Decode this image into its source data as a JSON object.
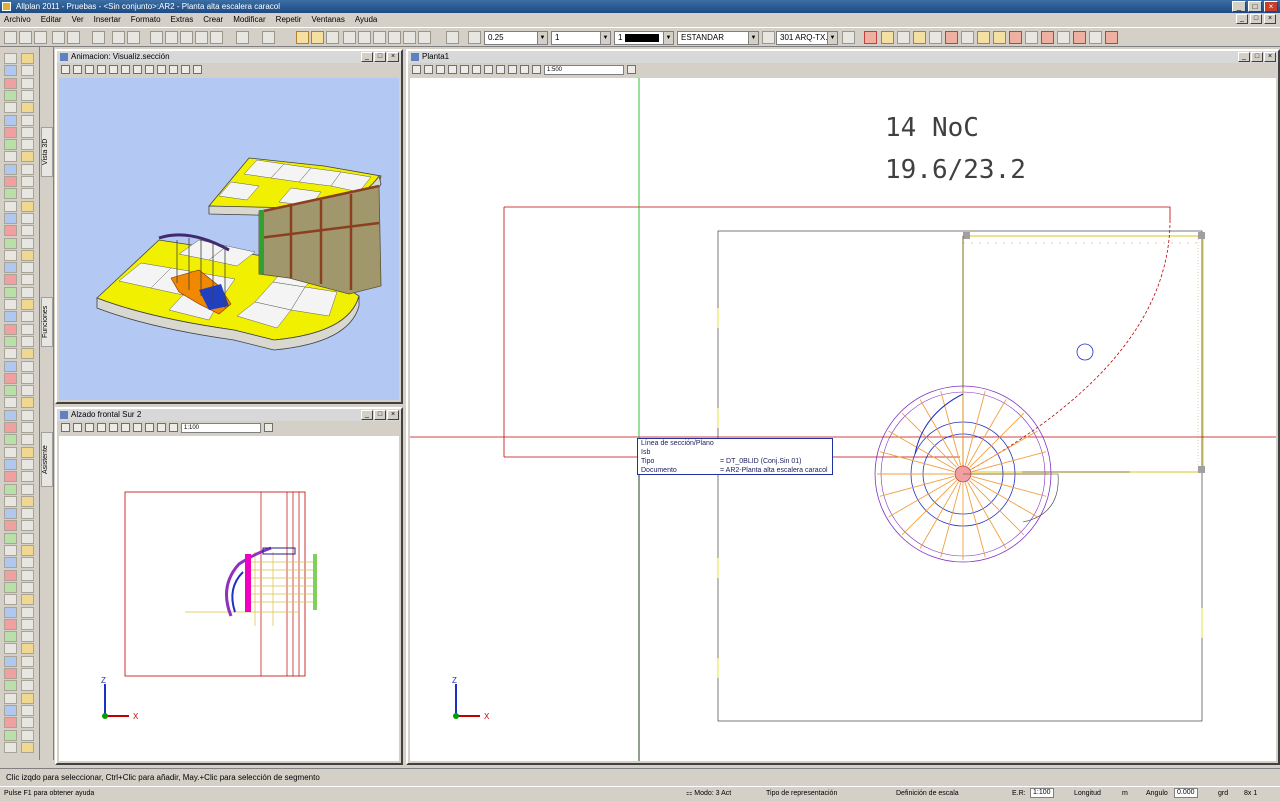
{
  "window": {
    "title": "Allplan 2011 - Pruebas - <Sin conjunto>:AR2 - Planta alta escalera caracol",
    "buttons": {
      "minimize": "_",
      "maximize": "□",
      "close": "×"
    }
  },
  "menu": {
    "items": [
      "Archivo",
      "Editar",
      "Ver",
      "Insertar",
      "Formato",
      "Extras",
      "Crear",
      "Modificar",
      "Repetir",
      "Ventanas",
      "Ayuda"
    ]
  },
  "toolbar": {
    "pen_value": "0.25",
    "line_value": "1",
    "color_value": "1",
    "layer_value": "ESTANDAR",
    "layer_code_value": "301 ARQ-TX..."
  },
  "panels": {
    "animation": {
      "title": "Animacion: Visualiz.sección"
    },
    "elevation": {
      "title": "Alzado frontal Sur 2",
      "zoom_value": "1:100"
    },
    "plan": {
      "title": "Planta1",
      "zoom_value": "1:500",
      "annotation_line1": "14 NoC",
      "annotation_line2": "19.6/23.2"
    }
  },
  "side_tabs": [
    "Vista 3D",
    "Funciones",
    "Asistente"
  ],
  "tooltip": {
    "row1_label": "Línea de sección/Plano",
    "row2_label": "Isb",
    "row3_label": "Tipo",
    "row3_value": "= DT_0BLID (Conj.Sin 01)",
    "row4_label": "Documento",
    "row4_value": "= AR2-Planta alta escalera caracol"
  },
  "axis_labels": {
    "z": "Z",
    "x": "X"
  },
  "status": {
    "message": "Clic izqdo para seleccionar, Ctrl+Clic para añadir, May.+Clic para selección de segmento",
    "help": "Pulse F1 para obtener ayuda",
    "mode_label": "Modo: 3 Act",
    "representation_label": "Tipo de representación",
    "scale_definition_label": "Definición de escala",
    "scale_label": "E.R:",
    "scale_value": "1:100",
    "length_label": "Longitud",
    "length_unit": "m",
    "angle_label": "Angulo",
    "angle_value": "0.000",
    "angle_unit": "grd",
    "ratio_value": "8x 1"
  },
  "colors": {
    "titlebar": "#1e4a82",
    "viewport_3d_bg": "#b4c8f4",
    "tile_yellow": "#f0f000",
    "crosshair_red": "#c00000",
    "crosshair_green": "#00b000"
  }
}
